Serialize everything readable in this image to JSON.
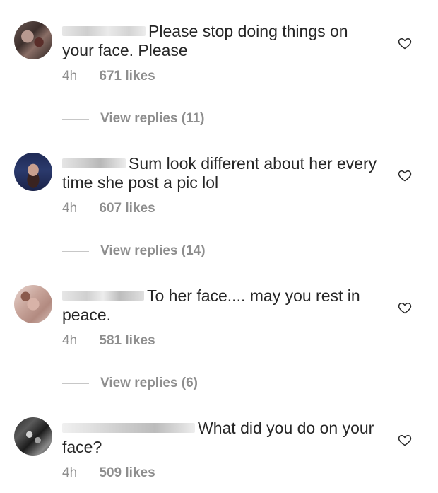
{
  "comments": [
    {
      "text": "Please stop doing things on your face.  Please",
      "time": "4h",
      "likes": "671 likes",
      "replies": "View replies (11)",
      "icon": "heart-outline-icon"
    },
    {
      "text": "Sum look different about her every time she post a pic lol",
      "time": "4h",
      "likes": "607 likes",
      "replies": "View replies (14)",
      "icon": "heart-outline-icon"
    },
    {
      "text": "To her face.... may you rest in peace.",
      "time": "4h",
      "likes": "581 likes",
      "replies": "View replies (6)",
      "icon": "heart-outline-icon"
    },
    {
      "text": "What did you do on your face?",
      "time": "4h",
      "likes": "509 likes",
      "icon": "heart-outline-icon"
    }
  ],
  "colors": {
    "text": "#262626",
    "secondary": "#8e8e8e",
    "divider": "#c7c7c7"
  }
}
